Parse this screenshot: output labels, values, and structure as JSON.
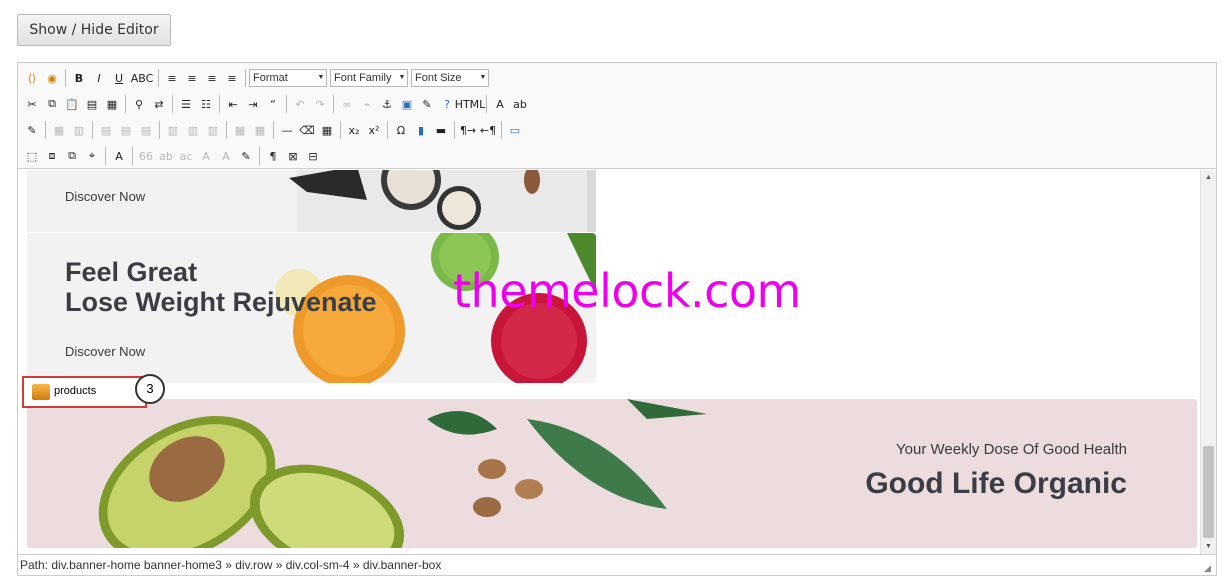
{
  "toggle_button": "Show / Hide Editor",
  "toolbar": {
    "combos": {
      "format": "Format",
      "font_family": "Font Family",
      "font_size": "Font Size"
    },
    "row1": [
      {
        "name": "sources-icon",
        "glyph": "⟨⟩"
      },
      {
        "name": "media-icon",
        "glyph": "◉"
      },
      {
        "name": "bold-icon",
        "glyph": "B"
      },
      {
        "name": "italic-icon",
        "glyph": "I"
      },
      {
        "name": "underline-icon",
        "glyph": "U"
      },
      {
        "name": "strikethrough-icon",
        "glyph": "ABC"
      },
      {
        "name": "align-left-icon",
        "glyph": "≡"
      },
      {
        "name": "align-center-icon",
        "glyph": "≡"
      },
      {
        "name": "align-right-icon",
        "glyph": "≡"
      },
      {
        "name": "align-justify-icon",
        "glyph": "≡"
      }
    ],
    "row2": [
      {
        "name": "cut-icon",
        "glyph": "✂"
      },
      {
        "name": "copy-icon",
        "glyph": "⧉"
      },
      {
        "name": "paste-icon",
        "glyph": "📋"
      },
      {
        "name": "paste-text-icon",
        "glyph": "▤"
      },
      {
        "name": "paste-word-icon",
        "glyph": "▦"
      },
      {
        "name": "find-icon",
        "glyph": "⚲"
      },
      {
        "name": "replace-icon",
        "glyph": "⇄"
      },
      {
        "name": "bullet-list-icon",
        "glyph": "☰"
      },
      {
        "name": "numbered-list-icon",
        "glyph": "☷"
      },
      {
        "name": "outdent-icon",
        "glyph": "⇤"
      },
      {
        "name": "indent-icon",
        "glyph": "⇥"
      },
      {
        "name": "blockquote-icon",
        "glyph": "“"
      },
      {
        "name": "undo-icon",
        "glyph": "↶"
      },
      {
        "name": "redo-icon",
        "glyph": "↷"
      },
      {
        "name": "link-icon",
        "glyph": "∞"
      },
      {
        "name": "unlink-icon",
        "glyph": "⌁"
      },
      {
        "name": "anchor-icon",
        "glyph": "⚓"
      },
      {
        "name": "image-icon",
        "glyph": "▣"
      },
      {
        "name": "cleanup-icon",
        "glyph": "✎"
      },
      {
        "name": "help-icon",
        "glyph": "?"
      },
      {
        "name": "html-icon",
        "glyph": "HTML"
      },
      {
        "name": "text-color-icon",
        "glyph": "A"
      },
      {
        "name": "highlight-color-icon",
        "glyph": "ab"
      }
    ],
    "row3": [
      {
        "name": "edit-icon",
        "glyph": "✎"
      },
      {
        "name": "table-icon",
        "glyph": "▦"
      },
      {
        "name": "table-props-icon",
        "glyph": "▥"
      },
      {
        "name": "row-before-icon",
        "glyph": "▤"
      },
      {
        "name": "row-after-icon",
        "glyph": "▤"
      },
      {
        "name": "delete-row-icon",
        "glyph": "▤"
      },
      {
        "name": "col-before-icon",
        "glyph": "▥"
      },
      {
        "name": "col-after-icon",
        "glyph": "▥"
      },
      {
        "name": "delete-col-icon",
        "glyph": "▥"
      },
      {
        "name": "split-cells-icon",
        "glyph": "▦"
      },
      {
        "name": "merge-cells-icon",
        "glyph": "▦"
      },
      {
        "name": "horizontal-rule-icon",
        "glyph": "—"
      },
      {
        "name": "remove-format-icon",
        "glyph": "⌫"
      },
      {
        "name": "visual-aid-icon",
        "glyph": "▦"
      },
      {
        "name": "subscript-icon",
        "glyph": "x₂"
      },
      {
        "name": "superscript-icon",
        "glyph": "x²"
      },
      {
        "name": "special-char-icon",
        "glyph": "Ω"
      },
      {
        "name": "media-insert-icon",
        "glyph": "▮"
      },
      {
        "name": "hr-line-icon",
        "glyph": "▬"
      },
      {
        "name": "ltr-icon",
        "glyph": "¶→"
      },
      {
        "name": "rtl-icon",
        "glyph": "←¶"
      },
      {
        "name": "fullscreen-icon",
        "glyph": "▭"
      }
    ],
    "row4": [
      {
        "name": "insert-layer-icon",
        "glyph": "⬚"
      },
      {
        "name": "move-forward-icon",
        "glyph": "⧈"
      },
      {
        "name": "move-backward-icon",
        "glyph": "⧉"
      },
      {
        "name": "absolute-icon",
        "glyph": "⌖"
      },
      {
        "name": "styles-icon",
        "glyph": "A"
      },
      {
        "name": "cite-icon",
        "glyph": "66"
      },
      {
        "name": "abbr-icon",
        "glyph": "ab"
      },
      {
        "name": "acronym-icon",
        "glyph": "ac"
      },
      {
        "name": "del-icon",
        "glyph": "A"
      },
      {
        "name": "ins-icon",
        "glyph": "A"
      },
      {
        "name": "attribs-icon",
        "glyph": "✎"
      },
      {
        "name": "visual-chars-icon",
        "glyph": "¶"
      },
      {
        "name": "nonbreaking-icon",
        "glyph": "⊠"
      },
      {
        "name": "pagebreak-icon",
        "glyph": "⊟"
      }
    ]
  },
  "content": {
    "banner1": {
      "link": "Discover Now"
    },
    "banner2": {
      "title_line1": "Feel Great",
      "title_line2": "Lose Weight Rejuvenate",
      "link": "Discover Now"
    },
    "watermark": "themelock.com",
    "products_tag": {
      "label": "products",
      "badge": "3"
    },
    "banner3": {
      "subtitle": "Your Weekly Dose Of Good Health",
      "title": "Good Life Organic"
    }
  },
  "statusbar": {
    "path": "Path: div.banner-home banner-home3 » div.row » div.col-sm-4 » div.banner-box"
  },
  "colors": {
    "watermark": "#ee00ee",
    "product_border": "#d33a3a",
    "banner_pink": "#ecdcdd"
  }
}
